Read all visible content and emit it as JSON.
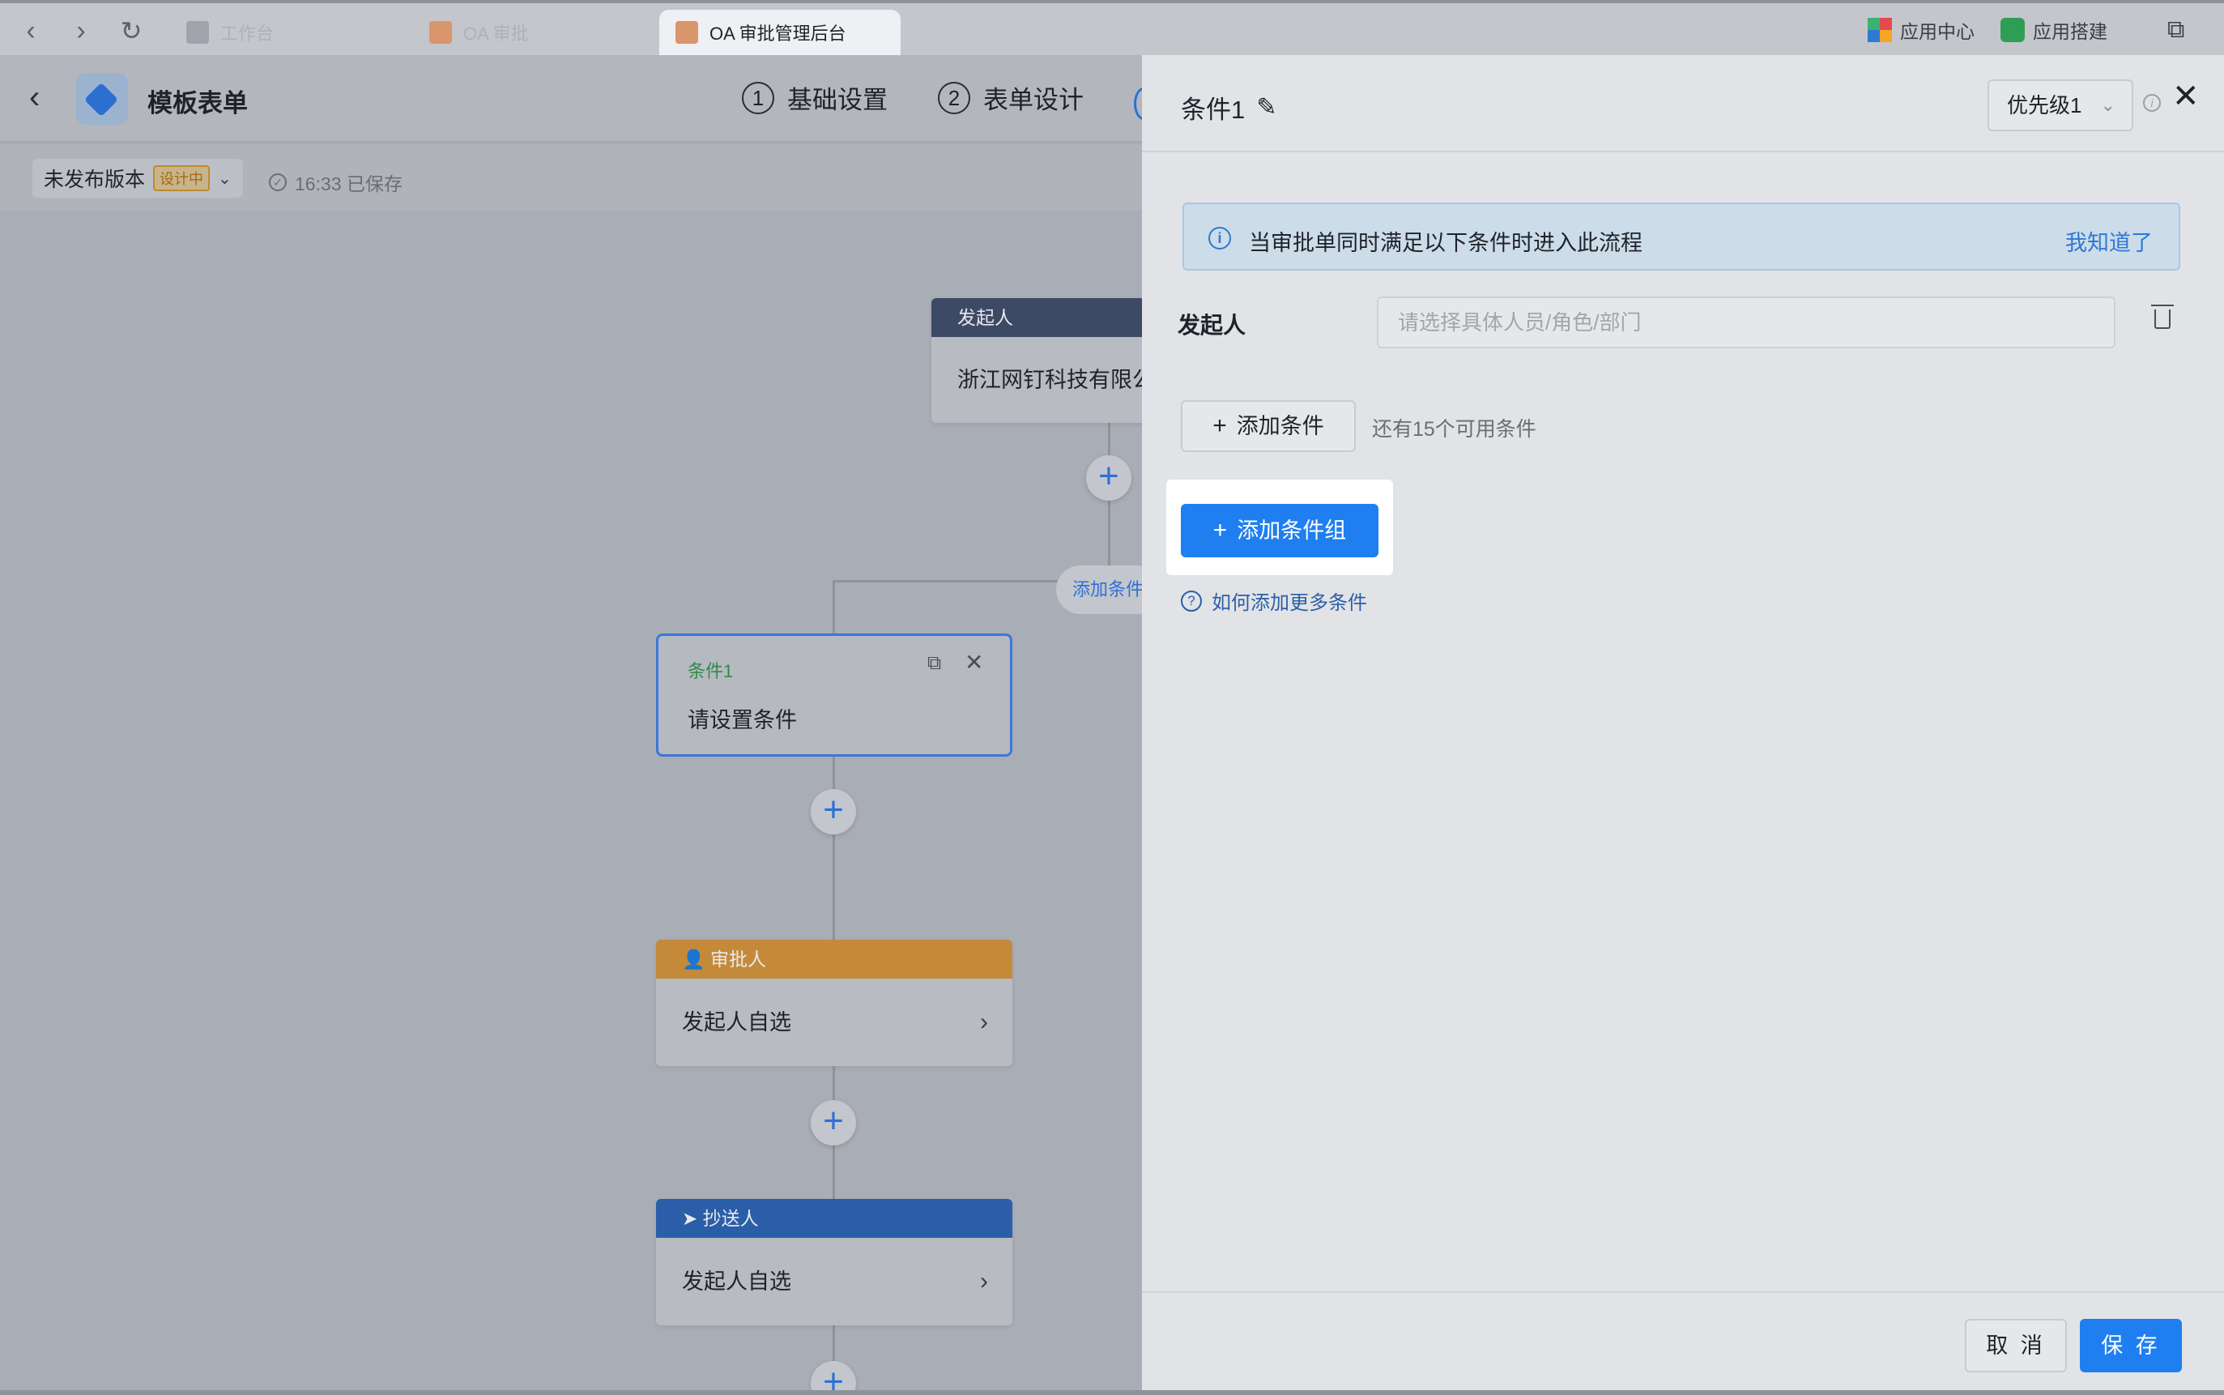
{
  "browser": {
    "tabs": [
      {
        "label": "工作台",
        "active": false
      },
      {
        "label": "OA 审批",
        "active": false
      },
      {
        "label": "OA 审批管理后台",
        "active": true
      }
    ],
    "right": {
      "app_center": "应用中心",
      "app_build": "应用搭建"
    }
  },
  "editor": {
    "title": "模板表单",
    "steps": [
      {
        "num": "1",
        "label": "基础设置"
      },
      {
        "num": "2",
        "label": "表单设计"
      }
    ],
    "version": {
      "label": "未发布版本",
      "badge": "设计中",
      "saved": "16:33 已保存"
    },
    "flow": {
      "initiator": {
        "header": "发起人",
        "body": "浙江网钉科技有限公"
      },
      "add_condition_pill": "添加条件",
      "condition": {
        "title": "条件1",
        "body": "请设置条件"
      },
      "approver": {
        "header": "审批人",
        "body": "发起人自选"
      },
      "cc": {
        "header": "抄送人",
        "body": "发起人自选"
      }
    }
  },
  "drawer": {
    "title": "条件1",
    "priority": "优先级1",
    "notice": {
      "text": "当审批单同时满足以下条件时进入此流程",
      "ack": "我知道了"
    },
    "field": {
      "label": "发起人",
      "placeholder": "请选择具体人员/角色/部门"
    },
    "add_condition": "添加条件",
    "remaining": "还有15个可用条件",
    "add_group": "添加条件组",
    "help": "如何添加更多条件",
    "cancel": "取 消",
    "save": "保 存"
  },
  "colors": {
    "primary": "#1f7ff0",
    "approver_header": "#c48a3a",
    "cc_header": "#2a5ea8",
    "initiator_header": "#3d4a66"
  }
}
